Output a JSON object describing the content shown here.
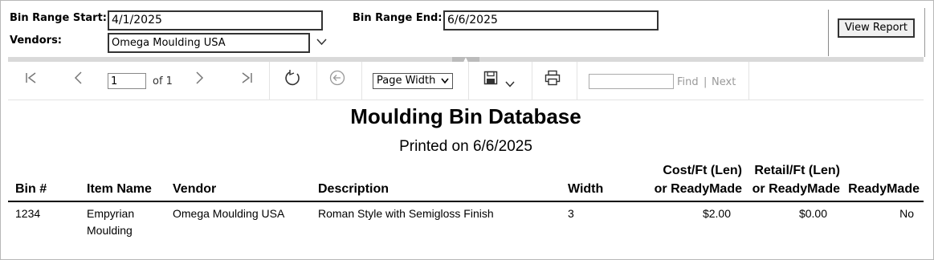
{
  "params": {
    "bin_start_label": "Bin Range Start:",
    "bin_start_value": "4/1/2025",
    "bin_end_label": "Bin Range End:",
    "bin_end_value": "6/6/2025",
    "vendors_label": "Vendors:",
    "vendors_value": "Omega Moulding USA",
    "view_report_label": "View Report"
  },
  "toolbar": {
    "page_value": "1",
    "of_text": "of 1",
    "zoom_value": "Page Width",
    "find_label": "Find",
    "separator": "|",
    "next_label": "Next"
  },
  "report": {
    "title": "Moulding Bin Database",
    "subtitle": "Printed on 6/6/2025",
    "columns": {
      "bin": "Bin #",
      "item": "Item Name",
      "vendor": "Vendor",
      "desc": "Description",
      "width": "Width",
      "cost_1": "Cost/Ft (Len)",
      "cost_2": "or ReadyMade",
      "retail_1": "Retail/Ft (Len)",
      "retail_2": "or ReadyMade",
      "readymade": "ReadyMade"
    },
    "rows": [
      {
        "bin": "1234",
        "item_1": "Empyrian",
        "item_2": "Moulding",
        "vendor": "Omega Moulding USA",
        "desc": "Roman Style with Semigloss Finish",
        "width": "3",
        "cost": "$2.00",
        "retail": "$0.00",
        "readymade": "No"
      }
    ]
  }
}
